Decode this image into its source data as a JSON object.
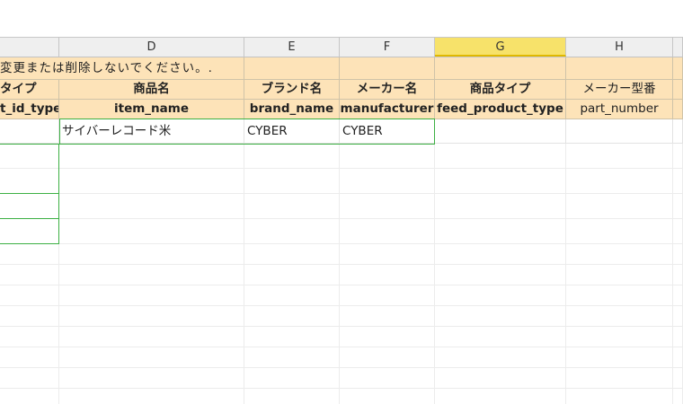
{
  "columns": [
    "D",
    "E",
    "F",
    "G",
    "H"
  ],
  "notice_row": {
    "text": "変更または削除しないでください。."
  },
  "jp_headers": {
    "c": "タイプ",
    "d": "商品名",
    "e": "ブランド名",
    "f": "メーカー名",
    "g": "商品タイプ",
    "h": "メーカー型番"
  },
  "field_headers": {
    "c": "t_id_type",
    "d": "item_name",
    "e": "brand_name",
    "f": "manufacturer",
    "g": "feed_product_type",
    "h": "part_number"
  },
  "data_rows": [
    {
      "c": "",
      "d": "サイバーレコード米",
      "e": "CYBER",
      "f": "CYBER",
      "g": "",
      "h": ""
    }
  ],
  "selected_column": "G",
  "colors": {
    "header_fill": "#fde3b8",
    "selected_column_header": "#f7e26a",
    "selection_border": "#3cb043"
  }
}
